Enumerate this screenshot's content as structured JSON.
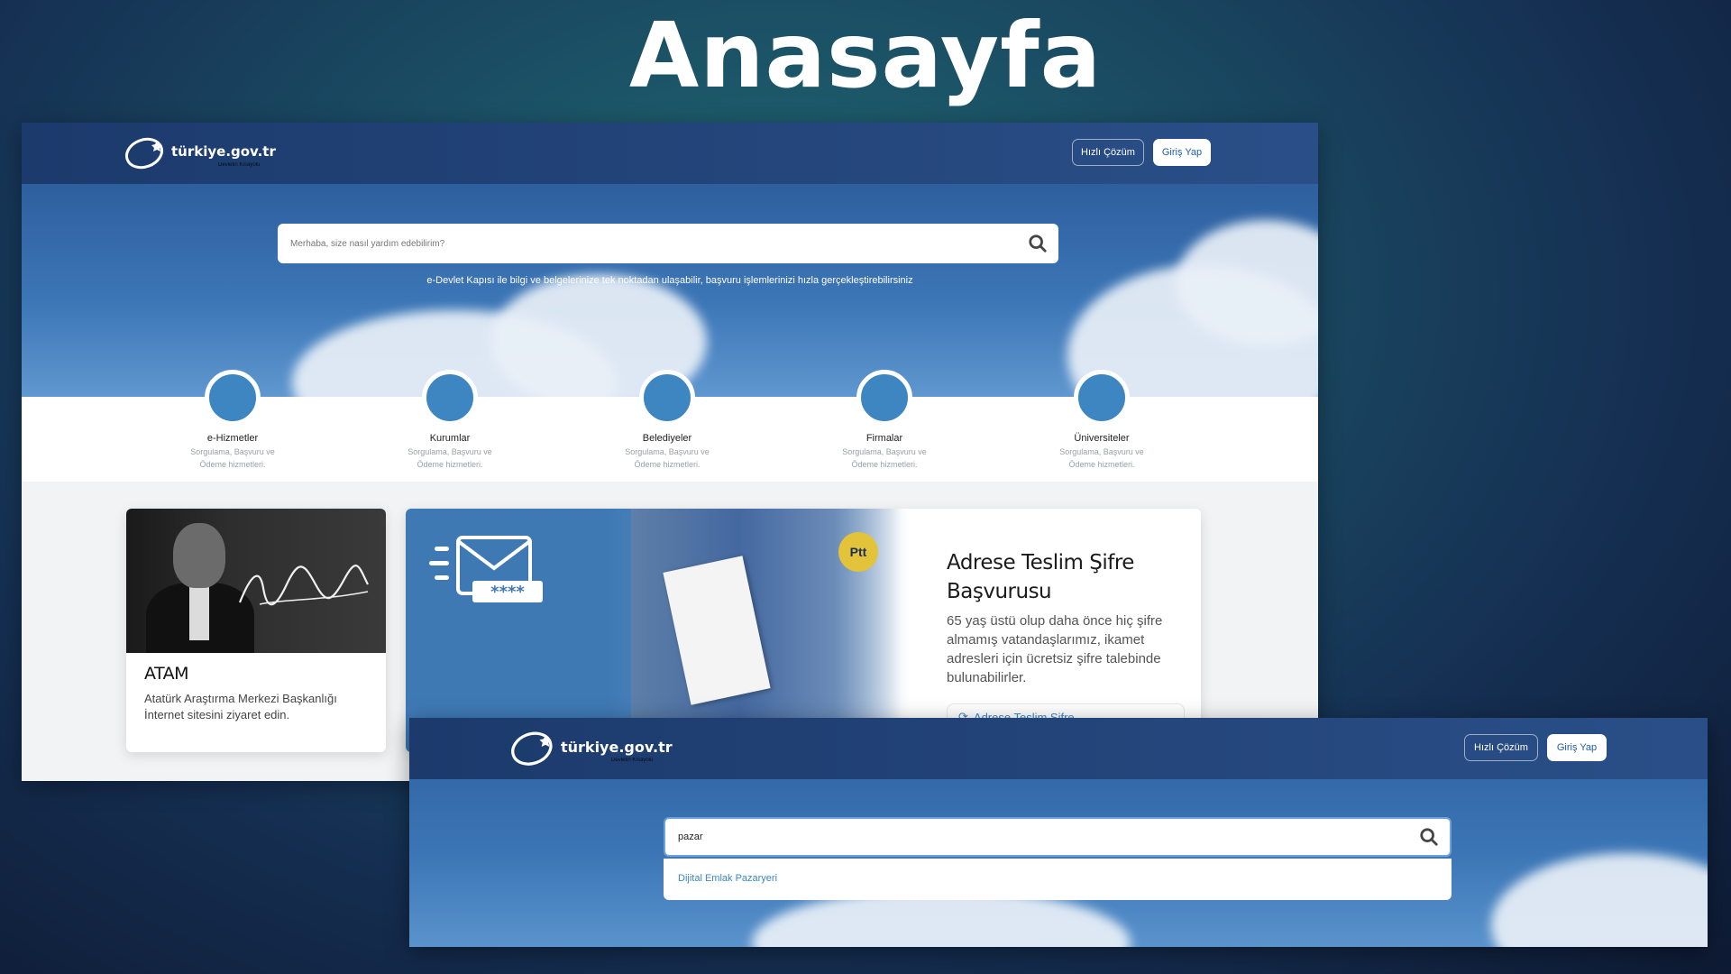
{
  "slide": {
    "title": "Anasayfa"
  },
  "brand": {
    "name": "türkiye.gov.tr",
    "tagline": "Devletin Kısayolu"
  },
  "header": {
    "quick_solution_label": "Hızlı Çözüm",
    "login_label": "Giriş Yap"
  },
  "search": {
    "placeholder": "Merhaba, size nasıl yardım edebilirim?",
    "tagline": "e-Devlet Kapısı ile bilgi ve belgelerinize tek noktadan ulaşabilir, başvuru işlemlerinizi hızla gerçekleştirebilirsiniz"
  },
  "categories": [
    {
      "title": "e-Hizmetler",
      "subtitle": "Sorgulama, Başvuru ve Ödeme hizmetleri."
    },
    {
      "title": "Kurumlar",
      "subtitle": "Sorgulama, Başvuru ve Ödeme hizmetleri."
    },
    {
      "title": "Belediyeler",
      "subtitle": "Sorgulama, Başvuru ve Ödeme hizmetleri."
    },
    {
      "title": "Firmalar",
      "subtitle": "Sorgulama, Başvuru ve Ödeme hizmetleri."
    },
    {
      "title": "Üniversiteler",
      "subtitle": "Sorgulama, Başvuru ve Ödeme hizmetleri."
    }
  ],
  "atam_card": {
    "title": "ATAM",
    "description": "Atatürk Araştırma Merkezi Başkanlığı İnternet sitesini ziyaret edin."
  },
  "promo_card": {
    "badge": "Ptt",
    "title": "Adrese Teslim Şifre Başvurusu",
    "description": "65 yaş üstü olup daha önce hiç şifre almamış vatandaşlarımız, ikamet adresleri için ücretsiz şifre talebinde bulunabilirler.",
    "link_label": "Adrese Teslim Şifre"
  },
  "search_demo": {
    "query": "pazar",
    "suggestions": [
      "Dijital Emlak Pazaryeri"
    ]
  },
  "colors": {
    "nav": "#24467c",
    "category_circle": "#3d86c2",
    "link": "#3d86c2"
  }
}
